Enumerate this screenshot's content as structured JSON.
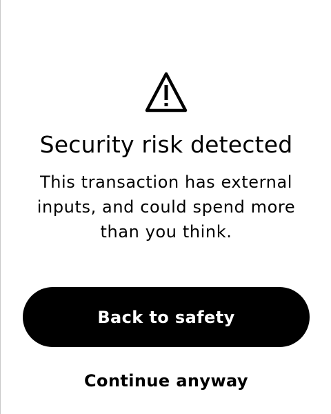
{
  "dialog": {
    "icon": "warning-triangle-icon",
    "title": "Security risk detected",
    "message": "This transaction has external inputs, and could spend more than you think.",
    "primary_button_label": "Back to safety",
    "secondary_button_label": "Continue anyway"
  },
  "colors": {
    "background": "#ffffff",
    "text": "#000000",
    "primary_button_background": "#000000",
    "primary_button_text": "#ffffff"
  }
}
